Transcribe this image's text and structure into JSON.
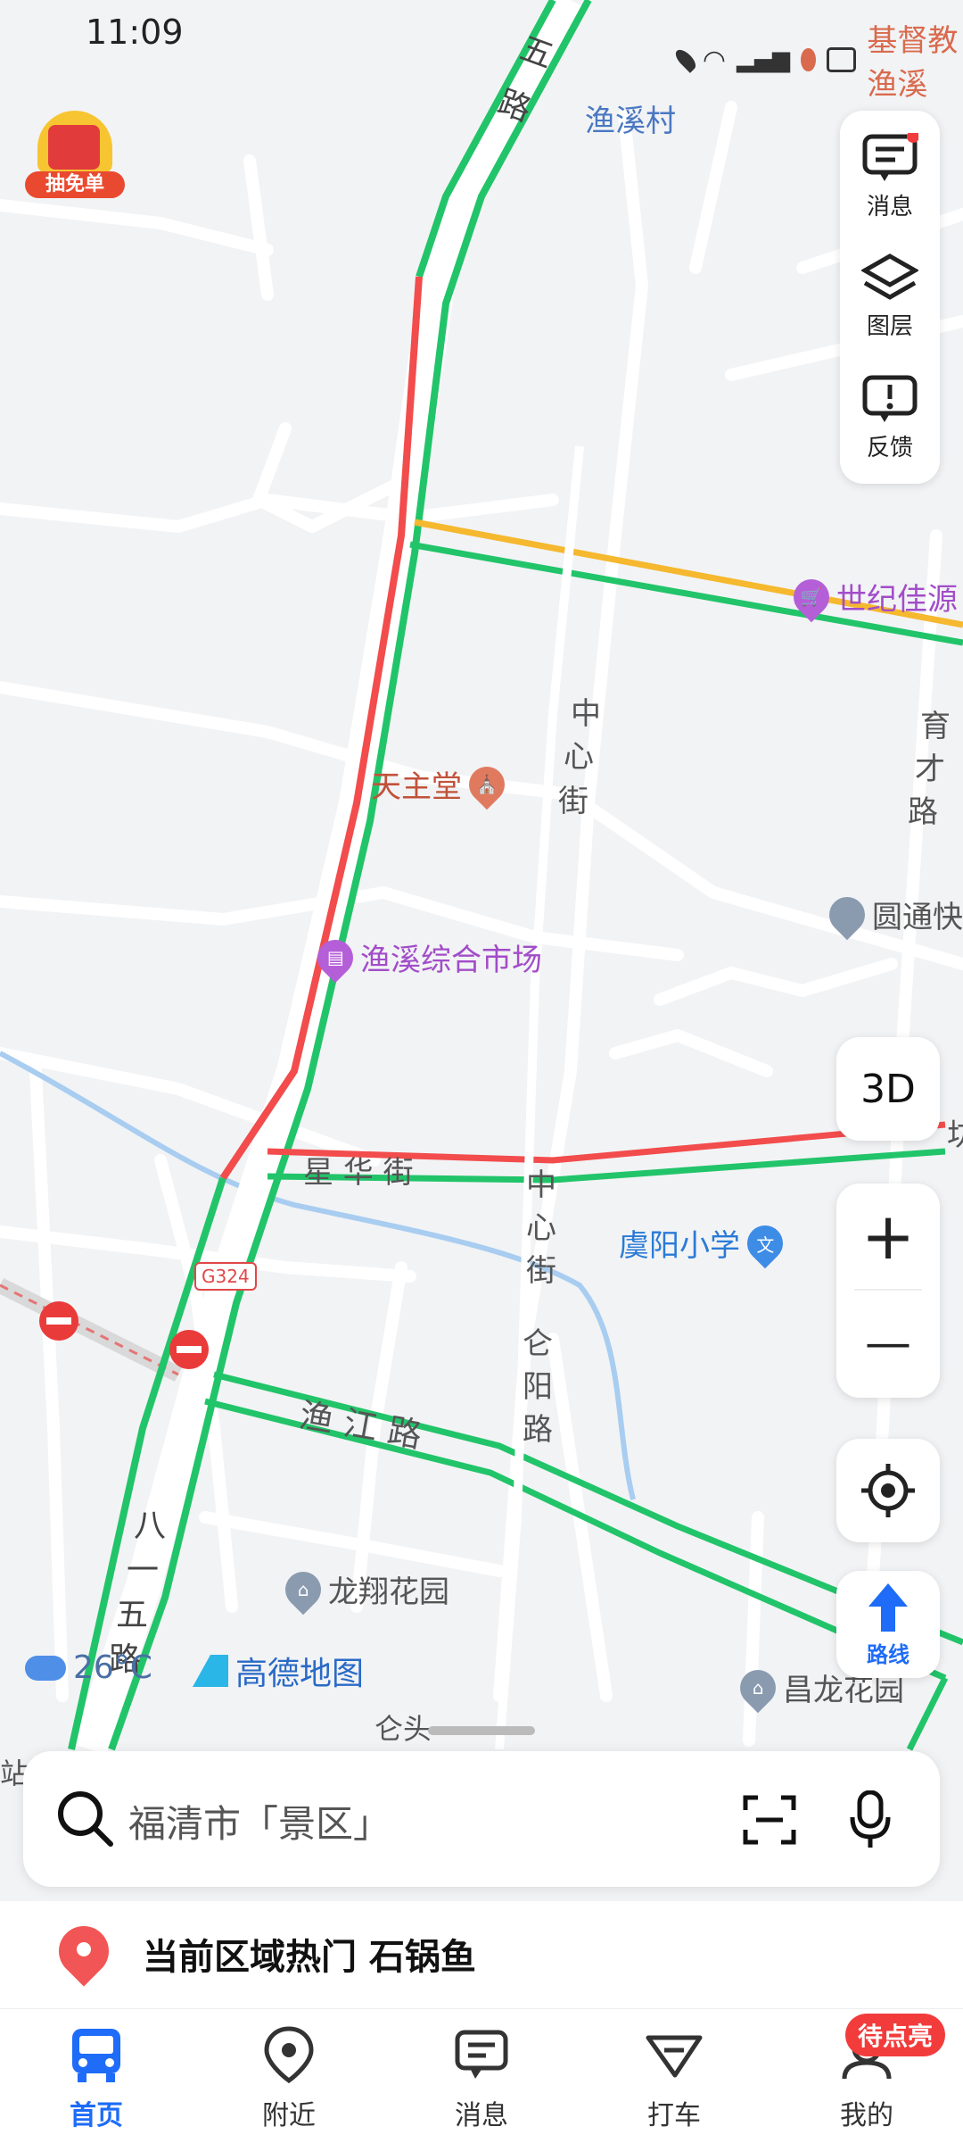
{
  "status_bar": {
    "time": "11:09",
    "notification_text": "基督教渔溪"
  },
  "map": {
    "road_labels": [
      "五",
      "路",
      "中",
      "心",
      "街",
      "育",
      "才",
      "路",
      "星 华 街",
      "中",
      "心",
      "街",
      "仑",
      "阳",
      "路",
      "渔 江 路",
      "八",
      "一",
      "五",
      "路",
      "仑头",
      "站",
      "G324",
      "坊"
    ],
    "pois": {
      "yuxi_village": "渔溪村",
      "century": "世纪佳源",
      "church": "天主堂",
      "market": "渔溪综合市场",
      "yuantong": "圆通快",
      "school": "虞阳小学",
      "longxiang": "龙翔花园",
      "changlong": "昌龙花园"
    },
    "weather": "26°C",
    "brand": "高德地图",
    "promo": "抽免单"
  },
  "toolbar": {
    "messages": "消息",
    "layers": "图层",
    "feedback": "反馈",
    "view3d": "3D",
    "zoom_in": "+",
    "zoom_out": "—",
    "route": "路线"
  },
  "search": {
    "placeholder": "福清市「景区」"
  },
  "hot": {
    "text": "当前区域热门 石锅鱼"
  },
  "tabs": [
    {
      "label": "首页",
      "icon": "bus-icon"
    },
    {
      "label": "附近",
      "icon": "location-pin-icon"
    },
    {
      "label": "消息",
      "icon": "message-icon"
    },
    {
      "label": "打车",
      "icon": "taxi-icon"
    },
    {
      "label": "我的",
      "icon": "profile-icon"
    }
  ],
  "profile_badge": "待点亮",
  "colors": {
    "accent": "#1e6cf7",
    "congested": "#f24c4c",
    "smooth": "#22c46a",
    "slow": "#f5b82e"
  }
}
